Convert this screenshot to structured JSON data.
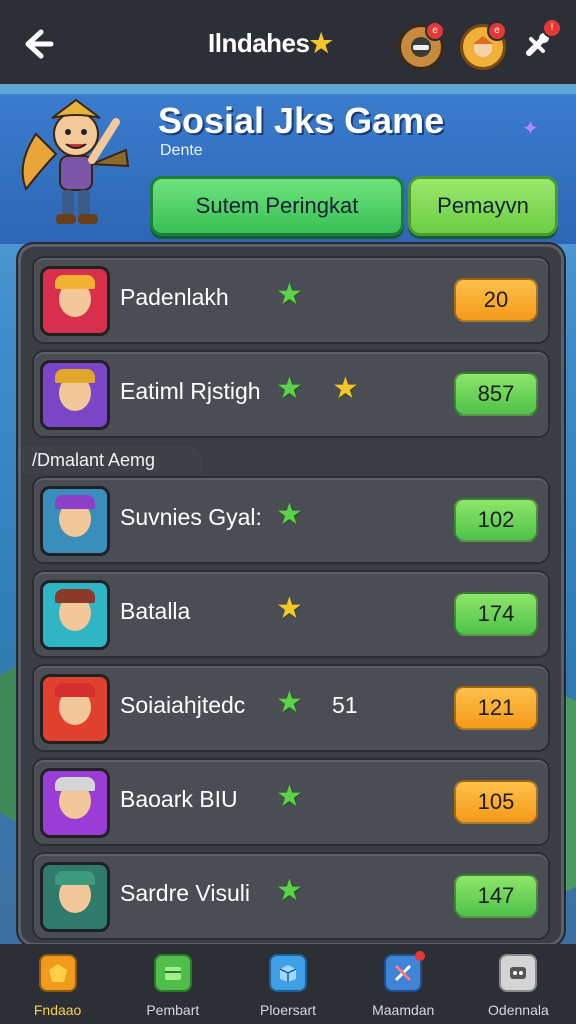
{
  "header": {
    "title": "Ilndahes",
    "star_glyph": "★",
    "icons": [
      {
        "name": "profile-icon",
        "badge": "e"
      },
      {
        "name": "friend-icon",
        "badge": "e"
      },
      {
        "name": "tools-icon",
        "badge": "!"
      }
    ]
  },
  "game": {
    "title": "Sosial Jks Game",
    "subtitle": "Dente",
    "tabs": [
      {
        "label": "Sutem Peringkat"
      },
      {
        "label": "Pemayvn"
      }
    ]
  },
  "section_label": "/Dmalant Aemg",
  "rows": [
    {
      "name": "Padenlakh",
      "stars": 1,
      "extra": "",
      "score": "20",
      "score_color": "orange",
      "avatar_bg": "#d8304c",
      "hat": "#f2b233"
    },
    {
      "name": "Eatiml Rjstigh",
      "stars": 2,
      "extra": "",
      "score": "857",
      "score_color": "green",
      "avatar_bg": "#7b45c8",
      "hat": "#e0a72a"
    },
    {
      "name": "Suvnies Gyal:",
      "stars": 1,
      "extra": "",
      "score": "102",
      "score_color": "green",
      "avatar_bg": "#3a8fba",
      "hat": "#8c3fc8"
    },
    {
      "name": "Batalla",
      "stars": 1,
      "extra": "",
      "score": "174",
      "score_color": "green",
      "avatar_bg": "#2fb5c3",
      "hat": "#8b3a2a",
      "star_color": "yellow"
    },
    {
      "name": "Soiaiahjtedc",
      "stars": 1,
      "extra": "51",
      "score": "121",
      "score_color": "orange",
      "avatar_bg": "#e0412f",
      "hat": "#d32f2f"
    },
    {
      "name": "Baoark BIU",
      "stars": 1,
      "extra": "",
      "score": "105",
      "score_color": "orange",
      "avatar_bg": "#9a3cd6",
      "hat": "#d5d5d5"
    },
    {
      "name": "Sardre Visuli",
      "stars": 1,
      "extra": "",
      "score": "147",
      "score_color": "green",
      "avatar_bg": "#2f7a6a",
      "hat": "#3c9b7c"
    }
  ],
  "nav": [
    {
      "label": "Fndaao",
      "icon": "home-icon",
      "color": "#f29a1c",
      "active": true
    },
    {
      "label": "Pembart",
      "icon": "shop-icon",
      "color": "#4fbf4a",
      "active": false
    },
    {
      "label": "Ploersart",
      "icon": "box-icon",
      "color": "#3fa0e6",
      "active": false
    },
    {
      "label": "Maamdan",
      "icon": "map-icon",
      "color": "#3f84d6",
      "active": false
    },
    {
      "label": "Odennala",
      "icon": "chat-icon",
      "color": "#d4d4d4",
      "active": false
    }
  ]
}
